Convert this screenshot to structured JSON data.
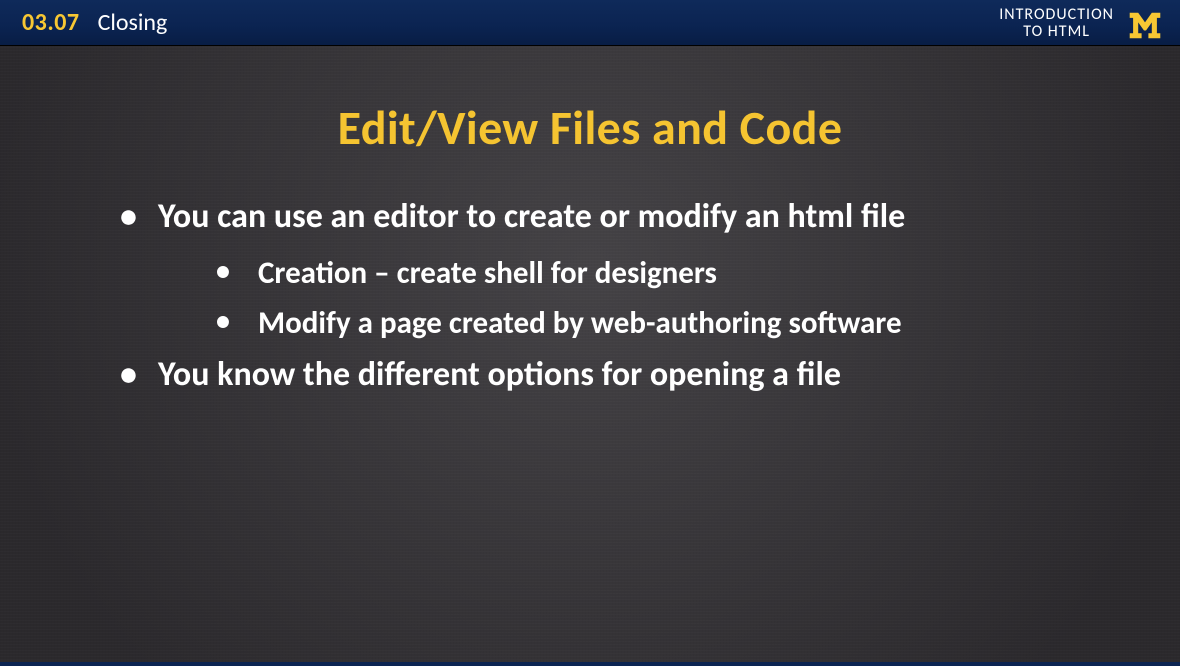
{
  "header": {
    "number": "03.07",
    "section": "Closing",
    "course_line1": "INTRODUCTION",
    "course_line2": "TO HTML"
  },
  "slide": {
    "title": "Edit/View Files and Code",
    "bullets": [
      {
        "text": "You can use an editor to create or modify an html file",
        "children": [
          "Creation – create shell for designers",
          "Modify a page created by web-authoring software"
        ]
      },
      {
        "text": "You know the different options for opening a file",
        "children": []
      }
    ]
  },
  "colors": {
    "accent_yellow": "#f5c431",
    "header_bg": "#0b2452",
    "body_bg": "#3e3c3f"
  }
}
